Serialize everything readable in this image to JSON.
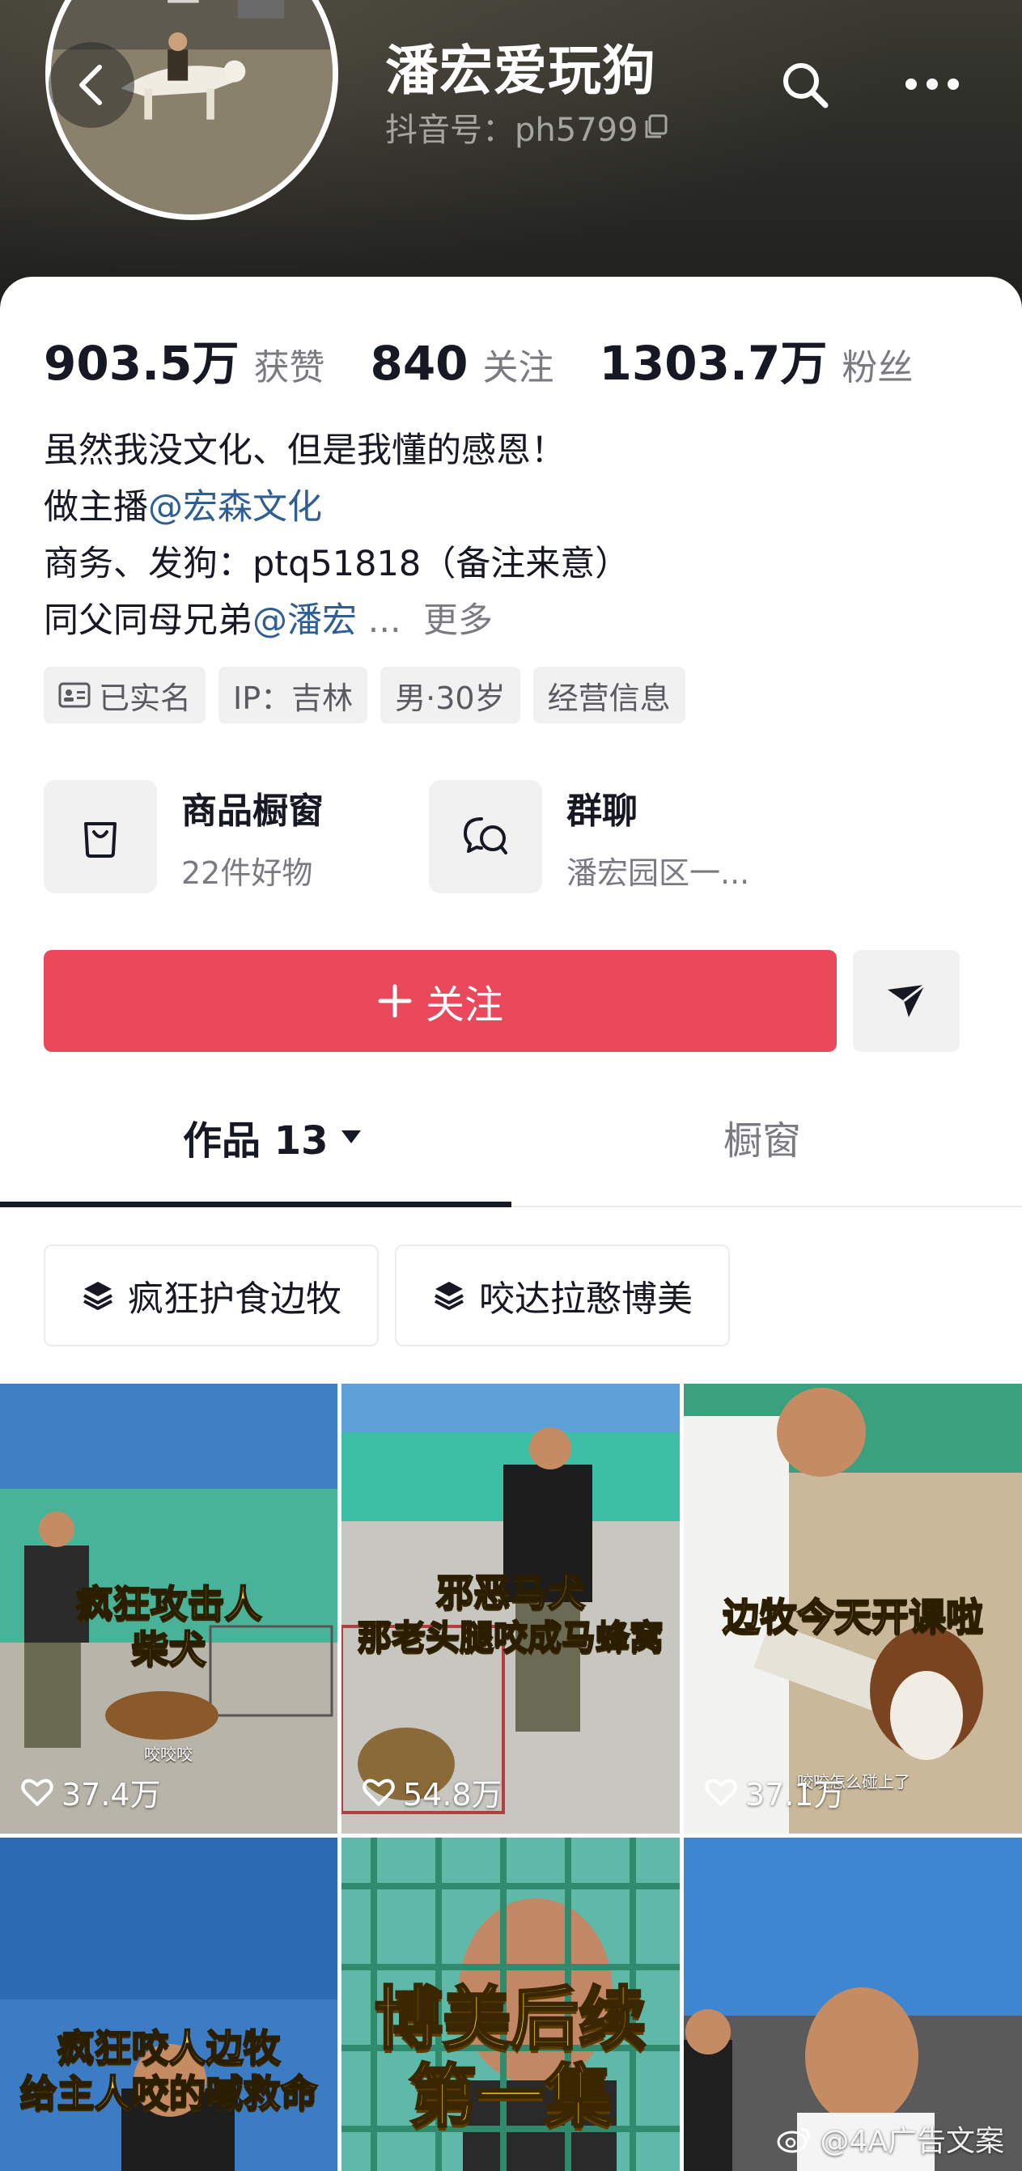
{
  "header": {
    "name": "潘宏爱玩狗",
    "douyin_id": "抖音号：ph5799"
  },
  "stats": [
    {
      "value": "903.5万",
      "label": "获赞"
    },
    {
      "value": "840",
      "label": "关注"
    },
    {
      "value": "1303.7万",
      "label": "粉丝"
    }
  ],
  "bio": {
    "line1": "虽然我没文化、但是我懂的感恩！",
    "line2_prefix": "做主播",
    "line2_mention": "@宏森文化",
    "line3": "商务、发狗：ptq51818（备注来意）",
    "line4_prefix": "同父同母兄弟",
    "line4_mention": "@潘宏",
    "line4_ellipsis": " ...",
    "more": "更多"
  },
  "tags": {
    "verified": "已实名",
    "ip": "IP：吉林",
    "profile": "男·30岁",
    "business": "经营信息"
  },
  "entries": {
    "shop_title": "商品橱窗",
    "shop_sub": "22件好物",
    "group_title": "群聊",
    "group_sub": "潘宏园区一..."
  },
  "follow_label": "关注",
  "tabs": {
    "works": "作品 13",
    "shop": "橱窗"
  },
  "collections": [
    "疯狂护食边牧",
    "咬达拉憨博美"
  ],
  "videos": [
    {
      "caption1": "疯狂攻击人",
      "caption2": "柴犬",
      "sub": "咬咬咬",
      "likes": "37.4万"
    },
    {
      "caption1": "邪恶马犬",
      "caption2": "那老头腿咬成马蜂窝",
      "likes": "54.8万"
    },
    {
      "caption1": "边牧今天开课啦",
      "sub": "咬咬怎么碰上了",
      "likes": "37.1万"
    },
    {
      "caption1": "疯狂咬人边牧",
      "caption2": "给主人咬的喊救命"
    },
    {
      "caption1": "博美后续",
      "caption2": "第一集"
    },
    {}
  ],
  "watermark": "@4A广告文案",
  "colors": {
    "follow_button": "#e9495b",
    "mention": "#2f5e94",
    "caption_yellow": "#f5d03a"
  }
}
